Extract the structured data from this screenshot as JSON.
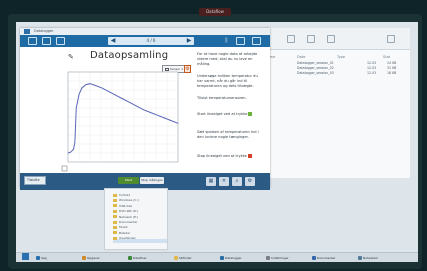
{
  "camera_label": "Dataflow",
  "explorer": {
    "headers": [
      "Name",
      "Date",
      "Type",
      "Size"
    ],
    "rows": [
      {
        "name": "Datalogger_session_01",
        "date": "12.03",
        "size": "24 KB"
      },
      {
        "name": "Datalogger_session_02",
        "date": "12.03",
        "size": "31 KB"
      },
      {
        "name": "Datalogger_session_03",
        "date": "12.03",
        "size": "18 KB"
      }
    ]
  },
  "app": {
    "window_title": "Datalogger",
    "nav_label": "4 / 6",
    "chart_title": "Dataopsamling",
    "legend_label": "Sensor 1",
    "sidepanel": [
      {
        "text": "For at have nogle data at arbejde videre med, skal du nu lave en måling.",
        "marker": "none"
      },
      {
        "text": "Undersøge hvilken temperatur du har varmt, når du går ind til temperaturen og dets tilvægte.",
        "marker": "none"
      },
      {
        "text": "Tilslut temperatursensoren.",
        "marker": "none"
      },
      {
        "text": "Start linealget ved at trykke",
        "marker": "green"
      },
      {
        "text": "Sæt spidsen af temperaturen ind i den lunkne nogle tænginger.",
        "marker": "none"
      },
      {
        "text": "Stop linealget ved at trykke",
        "marker": "red"
      }
    ],
    "mode_value": "Tilslutte",
    "start_label": "Start",
    "stop_label": "Stop målingen"
  },
  "chart_data": {
    "type": "line",
    "title": "Dataopsamling",
    "xlabel": "",
    "ylabel": "",
    "x": [
      0,
      2,
      4,
      5,
      6,
      8,
      10,
      13,
      16,
      20,
      25,
      30,
      35,
      40,
      45,
      50,
      55,
      60,
      65,
      70,
      75,
      80
    ],
    "y": [
      10,
      11,
      14,
      22,
      60,
      75,
      82,
      86,
      87,
      85,
      82,
      78,
      74,
      70,
      66,
      62,
      58,
      55,
      52,
      49,
      46,
      43
    ],
    "xlim": [
      0,
      80
    ],
    "ylim": [
      0,
      100
    ],
    "grid": true
  },
  "nav_pane": {
    "items": [
      "Indhold",
      "Windows (C:)",
      "USB-disk",
      "DVD-RW (D:)",
      "Netværk (E:)",
      "Dokumenter",
      "Musik",
      "Billeder",
      "Overførsler"
    ]
  },
  "taskbar": {
    "items": [
      "Søg",
      "Opgaver",
      "Dataflow",
      "Stifinder",
      "Datalogger",
      "Indstillinger",
      "Dokumenter",
      "Notesblok"
    ]
  }
}
